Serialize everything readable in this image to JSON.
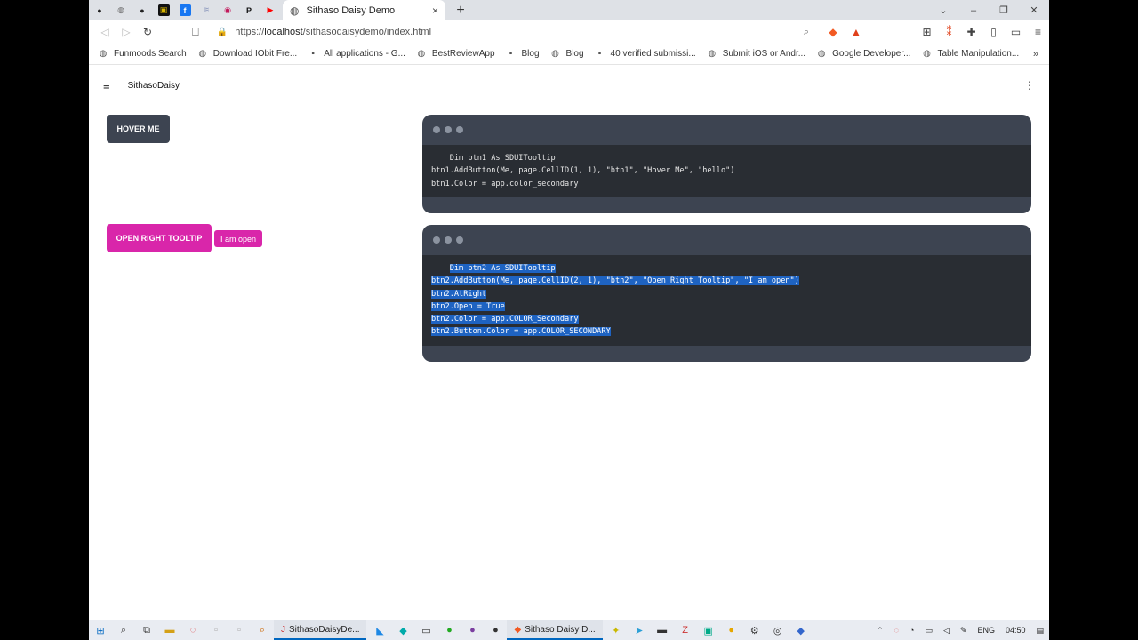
{
  "browser": {
    "pinned_tabs": [
      {
        "icon": "github-icon",
        "glyph": "●",
        "color": "#222222"
      },
      {
        "icon": "globe-icon",
        "glyph": "◍",
        "color": "#666666"
      },
      {
        "icon": "github-icon",
        "glyph": "●",
        "color": "#222222"
      },
      {
        "icon": "app-icon",
        "glyph": "▣",
        "color": "#d6b400"
      },
      {
        "icon": "facebook-icon",
        "glyph": "f",
        "color": "#ffffff"
      },
      {
        "icon": "layers-icon",
        "glyph": "≋",
        "color": "#9aa5c4"
      },
      {
        "icon": "reddit-icon",
        "glyph": "◉",
        "color": "#c2185b"
      },
      {
        "icon": "p-icon",
        "glyph": "P",
        "color": "#111111"
      },
      {
        "icon": "youtube-icon",
        "glyph": "▶",
        "color": "#ff0000"
      }
    ],
    "active_tab": {
      "title": "Sithaso Daisy Demo",
      "close": "×"
    },
    "new_tab": "+",
    "window_controls": {
      "dropdown": "⌄",
      "minimize": "–",
      "restore": "❐",
      "close": "✕"
    },
    "nav": {
      "back": "◁",
      "forward": "▷",
      "reload": "↻"
    },
    "url": {
      "prefix": "https://",
      "host": "localhost",
      "path": "/sithasodaisydemo/index.html"
    },
    "bookmarks": [
      {
        "label": "Funmoods Search",
        "icon": "globe-icon",
        "glyph": "◍"
      },
      {
        "label": "Download IObit Fre...",
        "icon": "globe-icon",
        "glyph": "◍"
      },
      {
        "label": "All applications - G...",
        "icon": "cn-icon",
        "glyph": "▪"
      },
      {
        "label": "BestReviewApp",
        "icon": "globe-icon",
        "glyph": "◍"
      },
      {
        "label": "Blog",
        "icon": "jr-icon",
        "glyph": "▪"
      },
      {
        "label": "Blog",
        "icon": "globe-icon",
        "glyph": "◍"
      },
      {
        "label": "40 verified submissi...",
        "icon": "site-icon",
        "glyph": "▪"
      },
      {
        "label": "Submit iOS or Andr...",
        "icon": "globe-icon",
        "glyph": "◍"
      },
      {
        "label": "Google Developer...",
        "icon": "globe-icon",
        "glyph": "◍"
      },
      {
        "label": "Table Manipulation...",
        "icon": "globe-icon",
        "glyph": "◍"
      }
    ],
    "bookmarks_more": "»"
  },
  "app": {
    "brand": "SithasoDaisy",
    "hover_button": "HOVER ME",
    "open_button": "OPEN RIGHT TOOLTIP",
    "tooltip": "I am open",
    "code1": [
      "    Dim btn1 As SDUITooltip",
      "btn1.AddButton(Me, page.CellID(1, 1), \"btn1\", \"Hover Me\", \"hello\")",
      "btn1.Color = app.color_secondary"
    ],
    "code2": [
      "    Dim btn2 As SDUITooltip",
      "btn2.AddButton(Me, page.CellID(2, 1), \"btn2\", \"Open Right Tooltip\", \"I am open\")",
      "btn2.AtRight",
      "btn2.Open = True",
      "btn2.Color = app.COLOR_Secondary",
      "btn2.Button.Color = app.COLOR_SECONDARY"
    ]
  },
  "taskbar": {
    "apps": [
      {
        "label": "SithasoDaisyDe...",
        "icon": "b4j-icon",
        "glyph": "J"
      },
      {
        "label": "Sithaso Daisy D...",
        "icon": "brave-icon",
        "glyph": "◆"
      }
    ],
    "lang": "ENG",
    "time": "04:50"
  },
  "colors": {
    "primary_button": "#3d4451",
    "secondary": "#d926aa",
    "selection": "#1e63c2"
  }
}
